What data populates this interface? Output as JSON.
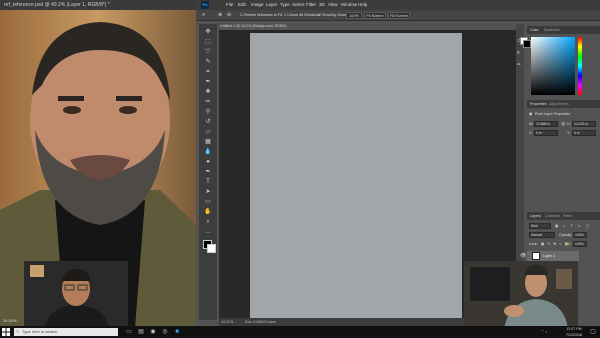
{
  "reference_window": {
    "title": "ref_reference.psd @ 49.2% (Layer 1, RGB/8*) *",
    "zoom": "24.00%"
  },
  "photoshop": {
    "menu": [
      "File",
      "Edit",
      "Image",
      "Layer",
      "Type",
      "Select",
      "Filter",
      "3D",
      "View",
      "Window",
      "Help"
    ],
    "options_bar": {
      "resize_windows": "Resize Windows to Fit",
      "zoom_all": "Zoom All Windows",
      "scrubby_zoom": "Scrubby Zoom",
      "zoom_value": "100%",
      "fit_screen": "Fit Screen",
      "fill_screen": "Fill Screen"
    },
    "document_tab": "Untitled-1 @ 44.2% (Background, RGB/8)",
    "status": {
      "zoom": "44.22%",
      "doc": "Doc: 6.59M/0 bytes"
    },
    "color_panel": {
      "tabs": [
        "Color",
        "Swatches"
      ]
    },
    "properties_panel": {
      "tabs": [
        "Properties",
        "Adjustments"
      ],
      "heading": "Pixel Layer Properties",
      "w_label": "W:",
      "w_value": "10.668 in",
      "h_label": "H:",
      "h_value": "14.222 in",
      "x_label": "X:",
      "x_value": "0 in",
      "y_label": "Y:",
      "y_value": "0 in"
    },
    "layers_panel": {
      "tabs": [
        "Layers",
        "Channels",
        "Paths"
      ],
      "kind_filter": "Kind",
      "blend_mode": "Normal",
      "opacity_label": "Opacity:",
      "opacity_value": "100%",
      "lock_label": "Lock:",
      "fill_label": "Fill:",
      "fill_value": "100%",
      "layer_name": "Layer 1"
    }
  },
  "taskbar": {
    "search_placeholder": "Type here to search",
    "time": "12:07 PM",
    "date": "7/13/2018"
  },
  "colors": {
    "canvas": "#a2a6aa",
    "ps_background": "#535353",
    "panel_dark": "#3c3c3c"
  }
}
